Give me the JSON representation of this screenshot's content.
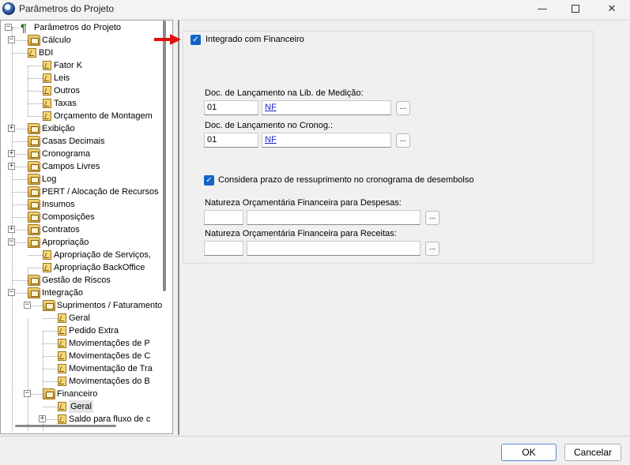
{
  "window": {
    "title": "Parâmetros do Projeto",
    "minimize_glyph": "—",
    "close_glyph": "✕"
  },
  "tree": {
    "root": "Parâmetros do Projeto",
    "items": [
      {
        "label": "Cálculo",
        "icon": "folder-icon",
        "expander": "−"
      },
      {
        "label": "BDI",
        "icon": "page-icon"
      },
      {
        "label": "Fator K",
        "icon": "page-icon"
      },
      {
        "label": "Leis",
        "icon": "page-icon"
      },
      {
        "label": "Outros",
        "icon": "page-icon"
      },
      {
        "label": "Taxas",
        "icon": "page-icon"
      },
      {
        "label": "Orçamento de Montagem",
        "icon": "page-icon"
      },
      {
        "label": "Exibição",
        "icon": "folder-icon",
        "expander": "+"
      },
      {
        "label": "Casas Decimais",
        "icon": "folder-icon"
      },
      {
        "label": "Cronograma",
        "icon": "folder-icon",
        "expander": "+"
      },
      {
        "label": "Campos Livres",
        "icon": "folder-icon",
        "expander": "+"
      },
      {
        "label": "Log",
        "icon": "folder-icon"
      },
      {
        "label": "PERT / Alocação de Recursos",
        "icon": "folder-icon"
      },
      {
        "label": "Insumos",
        "icon": "folder-icon"
      },
      {
        "label": "Composições",
        "icon": "folder-icon"
      },
      {
        "label": "Contratos",
        "icon": "folder-icon",
        "expander": "+"
      },
      {
        "label": "Apropriação",
        "icon": "folder-icon",
        "expander": "−"
      },
      {
        "label": "Apropriação de Serviços,",
        "icon": "page-icon"
      },
      {
        "label": "Apropriação BackOffice",
        "icon": "page-icon"
      },
      {
        "label": "Gestão de Riscos",
        "icon": "folder-icon"
      },
      {
        "label": "Integração",
        "icon": "folder-icon",
        "expander": "−"
      },
      {
        "label": "Suprimentos / Faturamento",
        "icon": "folder-icon",
        "expander": "−"
      },
      {
        "label": "Geral",
        "icon": "page-icon"
      },
      {
        "label": "Pedido Extra",
        "icon": "page-icon"
      },
      {
        "label": "Movimentações de P",
        "icon": "page-icon"
      },
      {
        "label": "Movimentações de C",
        "icon": "page-icon"
      },
      {
        "label": "Movimentação de Tra",
        "icon": "page-icon"
      },
      {
        "label": "Movimentações do B",
        "icon": "page-icon"
      },
      {
        "label": "Financeiro",
        "icon": "folder-icon",
        "expander": "−"
      },
      {
        "label": "Geral",
        "icon": "page-icon",
        "selected": true
      },
      {
        "label": "Saldo para fluxo de c",
        "icon": "page-icon",
        "expander": "+"
      }
    ]
  },
  "form": {
    "integrado_label": "Integrado com Financeiro",
    "integrado_checked": true,
    "doc_medicao_label": "Doc. de Lançamento na Lib. de Medição:",
    "doc_medicao_code": "01",
    "doc_medicao_link": "NF",
    "doc_cronog_label": "Doc. de Lançamento no Cronog.:",
    "doc_cronog_code": "01",
    "doc_cronog_link": "NF",
    "considera_label": "Considera prazo de ressuprimento no cronograma de desembolso",
    "considera_checked": true,
    "nat_despesas_label": "Natureza Orçamentária Financeira para Despesas:",
    "nat_despesas_code": "",
    "nat_despesas_desc": "",
    "nat_receitas_label": "Natureza Orçamentária Financeira para Receitas:",
    "nat_receitas_code": "",
    "nat_receitas_desc": "",
    "browse_label": "...",
    "check_glyph": "✓"
  },
  "buttons": {
    "ok": "OK",
    "cancel": "Cancelar"
  },
  "colors": {
    "accent": "#1464c8",
    "link": "#1b1bd4",
    "arrow": "#e01010"
  }
}
